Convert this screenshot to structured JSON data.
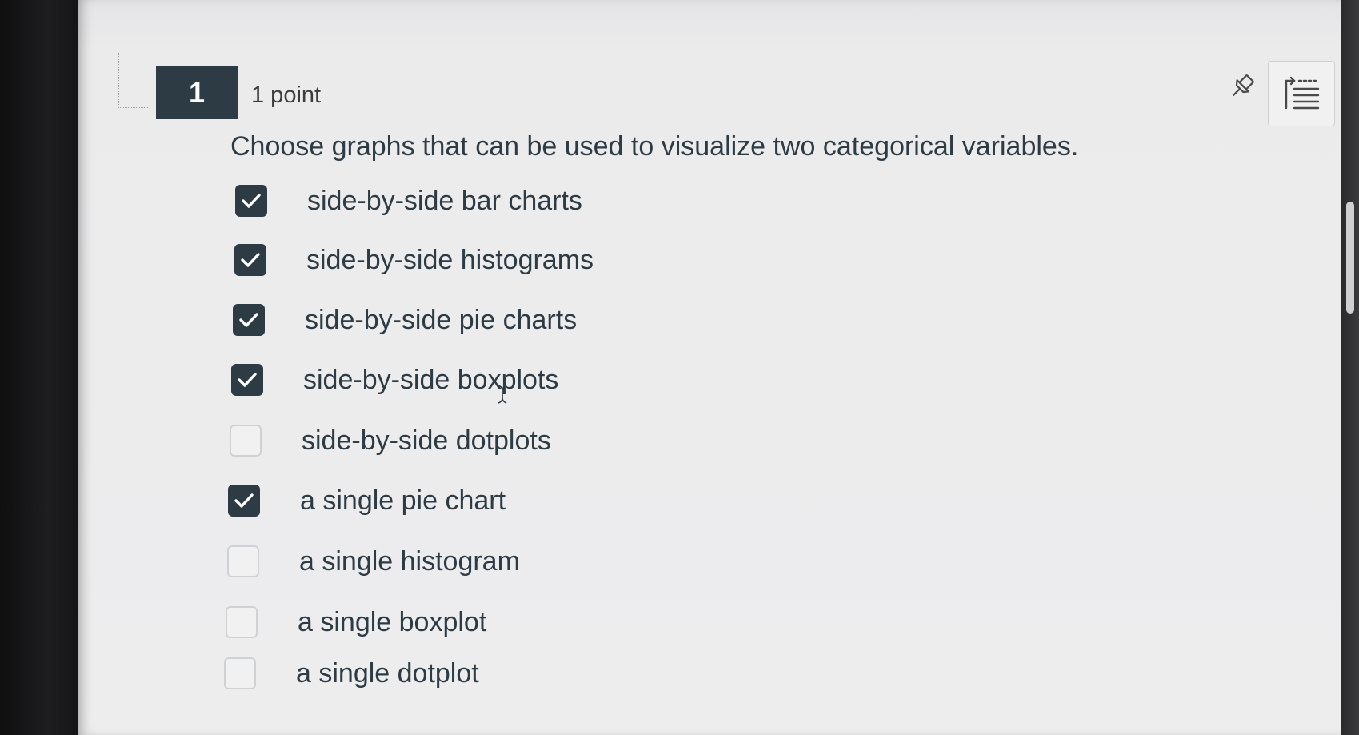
{
  "question": {
    "number": "1",
    "points": "1 point",
    "text": "Choose graphs that can be used to visualize two categorical variables."
  },
  "options": [
    {
      "label": "side-by-side bar charts",
      "checked": true
    },
    {
      "label": "side-by-side histograms",
      "checked": true
    },
    {
      "label": "side-by-side pie charts",
      "checked": true
    },
    {
      "label": "side-by-side boxplots",
      "checked": true
    },
    {
      "label": "side-by-side dotplots",
      "checked": false
    },
    {
      "label": "a single pie chart",
      "checked": true
    },
    {
      "label": "a single histogram",
      "checked": false
    },
    {
      "label": "a single boxplot",
      "checked": false
    },
    {
      "label": "a single dotplot",
      "checked": false
    }
  ],
  "icons": {
    "pin": "pin-icon",
    "outline": "outline-list-icon",
    "check": "checkmark-icon"
  },
  "colors": {
    "accent": "#2d3b45",
    "text": "#2d3b45",
    "panel": "#ececed"
  }
}
